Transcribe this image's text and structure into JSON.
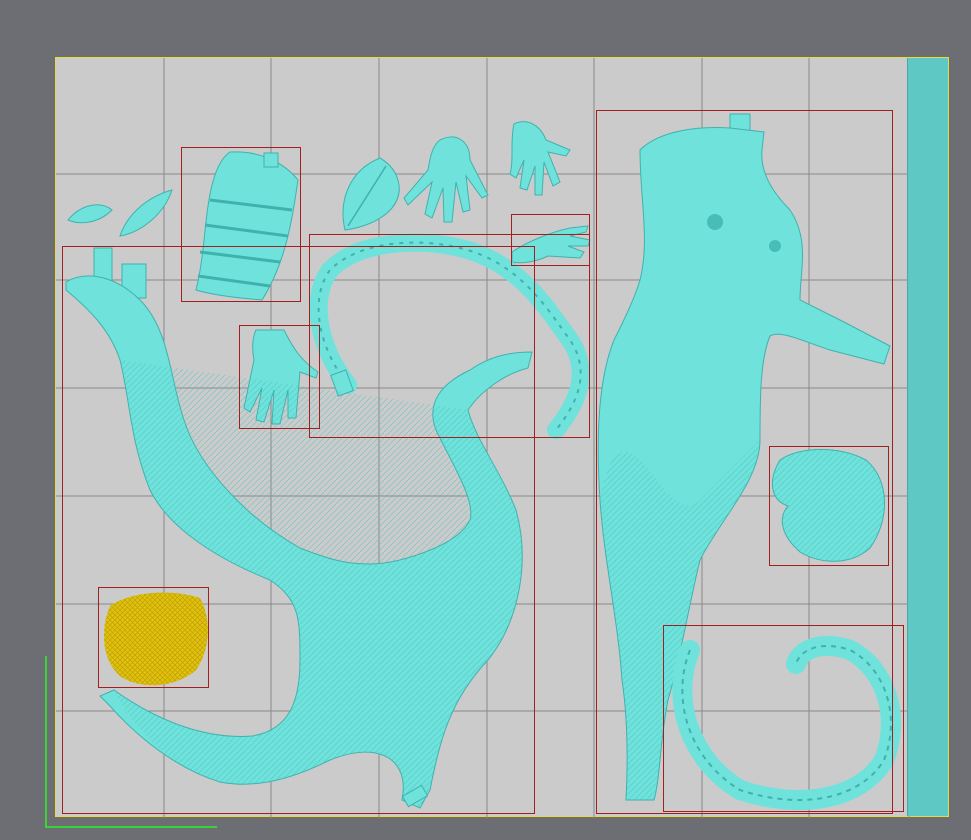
{
  "viewport": {
    "background_color": "#6c6e73",
    "plate_color": "#cbcbcb",
    "plate_border_color": "#e6dd3a",
    "grid_color": "#8a8a8a",
    "model_color": "#6fe2dc",
    "model_shadow_color": "#3fb2ad",
    "selected_model_color": "#e2c20c",
    "bounding_box_color": "#a02020",
    "axis_color": "#39d339",
    "side_strip_color": "#5ec8c4"
  },
  "parts": [
    {
      "name": "leaf-small-1",
      "selected": false
    },
    {
      "name": "leaf-small-2",
      "selected": false
    },
    {
      "name": "leaf-large-ornate",
      "selected": false
    },
    {
      "name": "leaf-medium",
      "selected": false
    },
    {
      "name": "hand-open-1",
      "selected": false
    },
    {
      "name": "hand-open-2",
      "selected": false
    },
    {
      "name": "hand-reaching",
      "selected": false
    },
    {
      "name": "hand-palm-up",
      "selected": false
    },
    {
      "name": "vine-tail-upper",
      "selected": false
    },
    {
      "name": "legs-pose",
      "selected": false
    },
    {
      "name": "torso",
      "selected": false
    },
    {
      "name": "hair-piece-right",
      "selected": false
    },
    {
      "name": "hair-piece-left",
      "selected": true
    },
    {
      "name": "vine-curl",
      "selected": false
    }
  ]
}
